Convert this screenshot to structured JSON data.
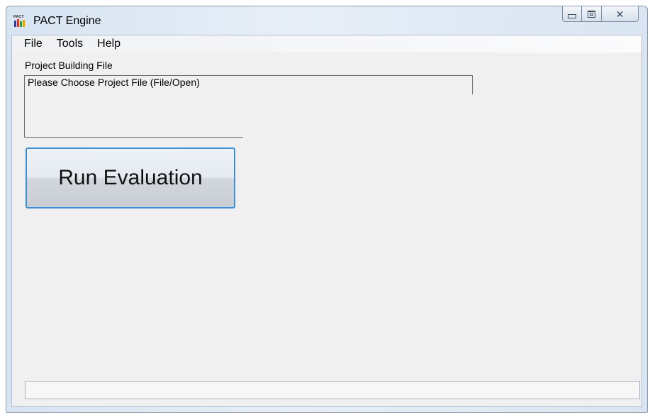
{
  "window": {
    "title": "PACT Engine",
    "icon": "pact-app-icon",
    "icon_text": "PACT",
    "caption_buttons": [
      "minimize-icon",
      "maximize-icon",
      "close-icon"
    ]
  },
  "menu": {
    "file": "File",
    "tools": "Tools",
    "help": "Help"
  },
  "project": {
    "label": "Project Building File",
    "value": "Please Choose Project File (File/Open)"
  },
  "actions": {
    "run_label": "Run Evaluation"
  },
  "status": {
    "text": ""
  },
  "colors": {
    "button_border": "#3c8fd4",
    "client_background": "#f0f0f0"
  }
}
